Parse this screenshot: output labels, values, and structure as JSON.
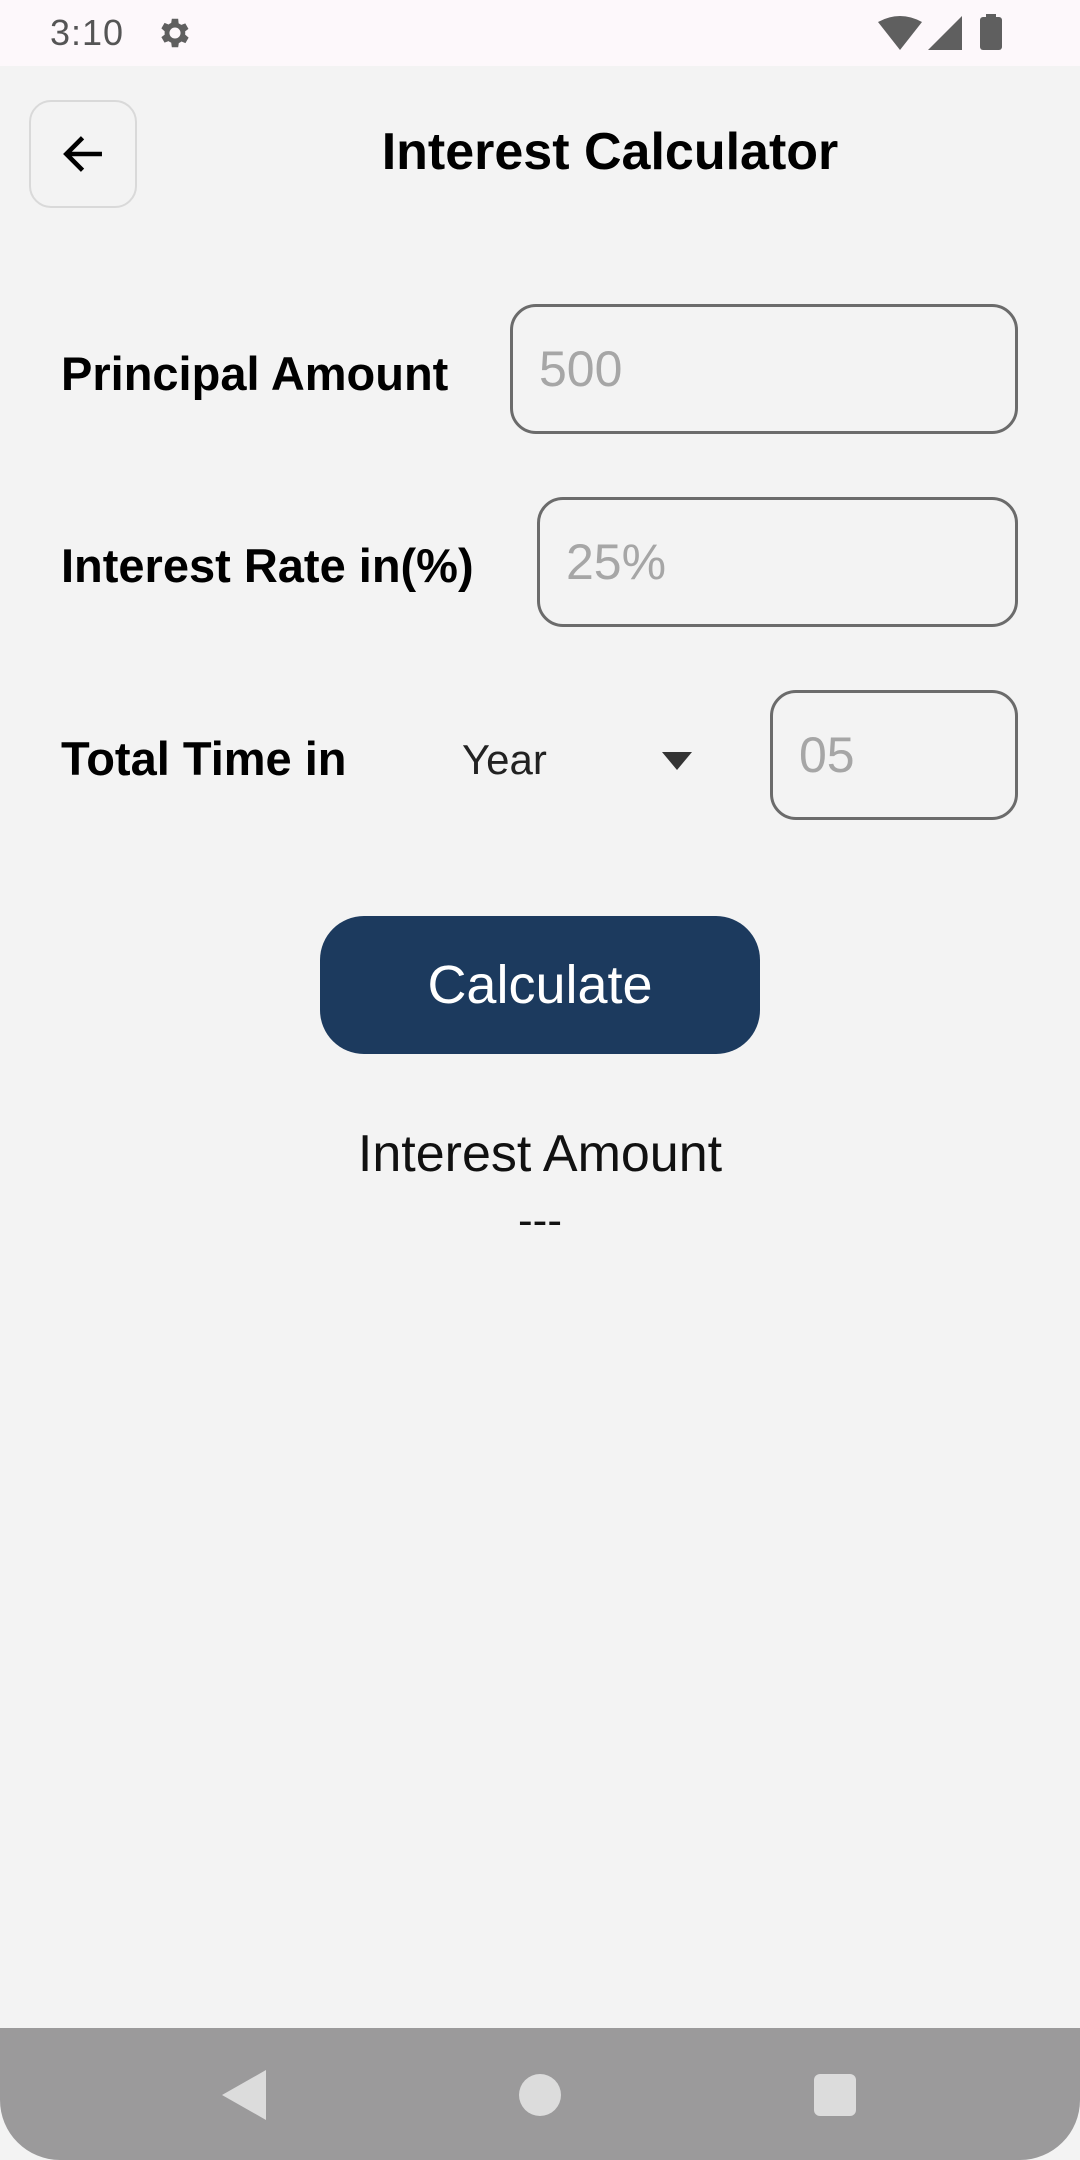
{
  "status_bar": {
    "time": "3:10",
    "icons": [
      "settings-icon",
      "wifi-icon",
      "signal-icon",
      "battery-icon"
    ]
  },
  "header": {
    "title": "Interest Calculator",
    "back_icon": "arrow-left-icon"
  },
  "form": {
    "principal": {
      "label": "Principal Amount",
      "value": "",
      "placeholder": "500"
    },
    "rate": {
      "label": "Interest Rate in(%)",
      "value": "",
      "placeholder": "25%"
    },
    "time": {
      "label": "Total Time in",
      "unit_selected": "Year",
      "value": "",
      "placeholder": "05"
    }
  },
  "actions": {
    "calculate_label": "Calculate"
  },
  "result": {
    "label": "Interest Amount",
    "value": "---"
  },
  "nav_bar": {
    "icons": [
      "back-triangle-icon",
      "home-circle-icon",
      "recents-square-icon"
    ]
  },
  "colors": {
    "background": "#f3f3f3",
    "button_primary": "#1c3a5e",
    "input_border": "#6b6b6b",
    "placeholder": "#a6a6a6",
    "nav_bar": "#9b9a9b"
  }
}
